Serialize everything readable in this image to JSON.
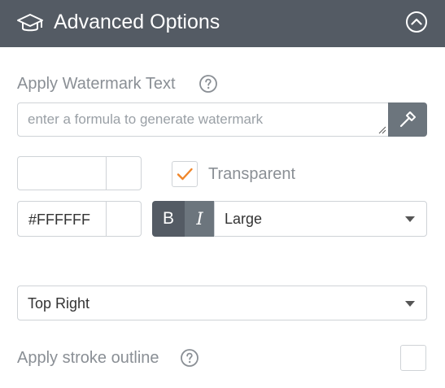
{
  "header": {
    "title": "Advanced Options",
    "icon": "graduation-cap-icon",
    "collapse_icon": "chevron-up-circle-icon",
    "background": "#545b64"
  },
  "watermark": {
    "label": "Apply Watermark Text",
    "placeholder": "enter a formula to generate watermark",
    "value": "",
    "formula_button_icon": "hammer-icon"
  },
  "font_size": {
    "value": "",
    "unit": ""
  },
  "transparent": {
    "label": "Transparent",
    "checked": true,
    "check_color": "#f0862a"
  },
  "color": {
    "value": "#FFFFFF"
  },
  "style_buttons": {
    "bold_label": "B",
    "italic_label": "I"
  },
  "size_select": {
    "selected": "Large"
  },
  "position_select": {
    "selected": "Top Right"
  },
  "stroke": {
    "label": "Apply stroke outline",
    "checked": false
  }
}
